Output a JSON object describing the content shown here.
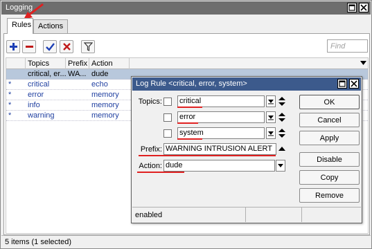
{
  "window": {
    "title": "Logging"
  },
  "tabs": [
    {
      "label": "Rules"
    },
    {
      "label": "Actions"
    }
  ],
  "toolbar": {
    "find_placeholder": "Find"
  },
  "grid": {
    "columns": [
      "Topics",
      "Prefix",
      "Action"
    ],
    "rows": [
      {
        "marker": "",
        "topics": "critical, er...",
        "prefix": "WA...",
        "action": "dude",
        "selected": true
      },
      {
        "marker": "*",
        "topics": "critical",
        "prefix": "",
        "action": "echo"
      },
      {
        "marker": "*",
        "topics": "error",
        "prefix": "",
        "action": "memory"
      },
      {
        "marker": "*",
        "topics": "info",
        "prefix": "",
        "action": "memory"
      },
      {
        "marker": "*",
        "topics": "warning",
        "prefix": "",
        "action": "memory"
      }
    ]
  },
  "status": "5 items (1 selected)",
  "dialog": {
    "title": "Log Rule <critical, error, system>",
    "topics_label": "Topics:",
    "topics": [
      "critical",
      "error",
      "system"
    ],
    "prefix_label": "Prefix:",
    "prefix_value": "WARNING INTRUSION ALERT",
    "action_label": "Action:",
    "action_value": "dude",
    "buttons": {
      "ok": "OK",
      "cancel": "Cancel",
      "apply": "Apply",
      "disable": "Disable",
      "copy": "Copy",
      "remove": "Remove"
    },
    "status": "enabled"
  },
  "colors": {
    "annotation": "#e02020",
    "titlebar": "#6e6e6e",
    "dialog_titlebar": "#3c5a8c",
    "selection": "#b8c8dc"
  }
}
